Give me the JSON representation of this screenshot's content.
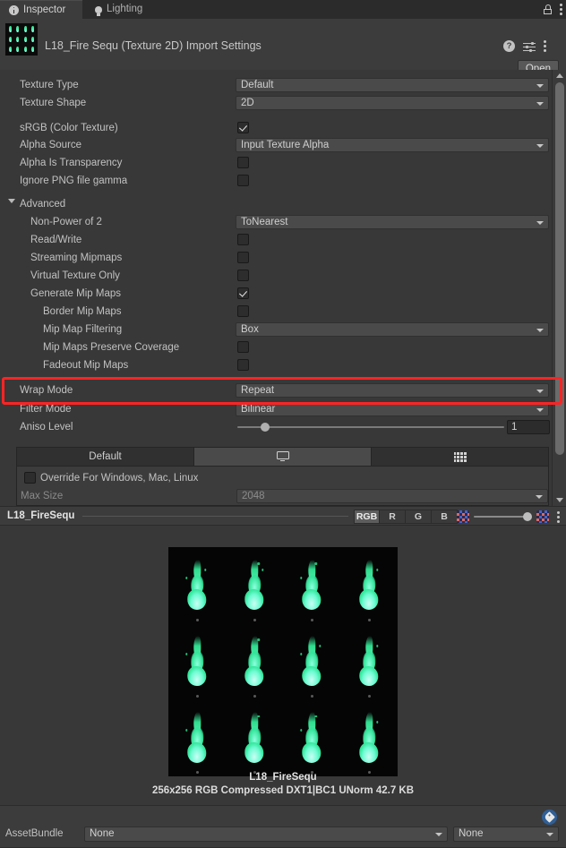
{
  "window": {
    "tabs": [
      {
        "label": "Inspector",
        "icon": "info-icon",
        "active": true
      },
      {
        "label": "Lighting",
        "icon": "bulb-icon",
        "active": false
      }
    ],
    "lock_icon": "lock-icon",
    "menu_icon": "kebab-menu-icon"
  },
  "header": {
    "title": "L18_Fire Sequ (Texture 2D) Import Settings",
    "help_icon": "help-icon",
    "preset_icon": "preset-icon",
    "menu_icon": "kebab-menu-icon",
    "open_label": "Open"
  },
  "properties": {
    "texture_type": {
      "label": "Texture Type",
      "value": "Default"
    },
    "texture_shape": {
      "label": "Texture Shape",
      "value": "2D"
    },
    "srgb": {
      "label": "sRGB (Color Texture)",
      "checked": true
    },
    "alpha_source": {
      "label": "Alpha Source",
      "value": "Input Texture Alpha"
    },
    "alpha_is_transparency": {
      "label": "Alpha Is Transparency",
      "checked": false
    },
    "ignore_png_gamma": {
      "label": "Ignore PNG file gamma",
      "checked": false
    },
    "advanced": {
      "label": "Advanced",
      "expanded": true
    },
    "non_power_of_2": {
      "label": "Non-Power of 2",
      "value": "ToNearest"
    },
    "read_write": {
      "label": "Read/Write",
      "checked": false
    },
    "streaming_mipmaps": {
      "label": "Streaming Mipmaps",
      "checked": false
    },
    "virtual_texture_only": {
      "label": "Virtual Texture Only",
      "checked": false
    },
    "generate_mip_maps": {
      "label": "Generate Mip Maps",
      "checked": true
    },
    "border_mip_maps": {
      "label": "Border Mip Maps",
      "checked": false
    },
    "mip_map_filtering": {
      "label": "Mip Map Filtering",
      "value": "Box"
    },
    "mip_maps_preserve_coverage": {
      "label": "Mip Maps Preserve Coverage",
      "checked": false
    },
    "fadeout_mip_maps": {
      "label": "Fadeout Mip Maps",
      "checked": false
    },
    "wrap_mode": {
      "label": "Wrap Mode",
      "value": "Repeat",
      "highlighted": true
    },
    "filter_mode": {
      "label": "Filter Mode",
      "value": "Bilinear"
    },
    "aniso_level": {
      "label": "Aniso Level",
      "value": "1"
    }
  },
  "platform": {
    "tabs": [
      {
        "label": "Default",
        "icon": "",
        "active": false
      },
      {
        "label": "",
        "icon": "monitor-icon",
        "active": true
      },
      {
        "label": "",
        "icon": "server-grid-icon",
        "active": false
      }
    ],
    "override": {
      "label": "Override For Windows, Mac, Linux",
      "checked": false
    },
    "max_size": {
      "label": "Max Size",
      "value": "2048"
    }
  },
  "preview": {
    "name": "L18_FireSequ",
    "channels": [
      {
        "label": "RGB",
        "active": true
      },
      {
        "label": "R",
        "active": false
      },
      {
        "label": "G",
        "active": false
      },
      {
        "label": "B",
        "active": false
      }
    ],
    "checker_icon_left": "checker-pattern-icon",
    "checker_icon_right": "checker-pattern-icon",
    "menu_icon": "kebab-menu-icon",
    "image_label": "L18_FireSequ",
    "image_info": "256x256  RGB Compressed DXT1|BC1 UNorm   42.7 KB"
  },
  "footer": {
    "tag_icon": "tag-icon",
    "assetbundle_label": "AssetBundle",
    "assetbundle_value": "None",
    "assetbundle_variant": "None"
  },
  "colors": {
    "highlight": "#fc2424",
    "panel": "#383838",
    "field": "#4a4a4a",
    "accent_badge": "#2f5f96"
  }
}
